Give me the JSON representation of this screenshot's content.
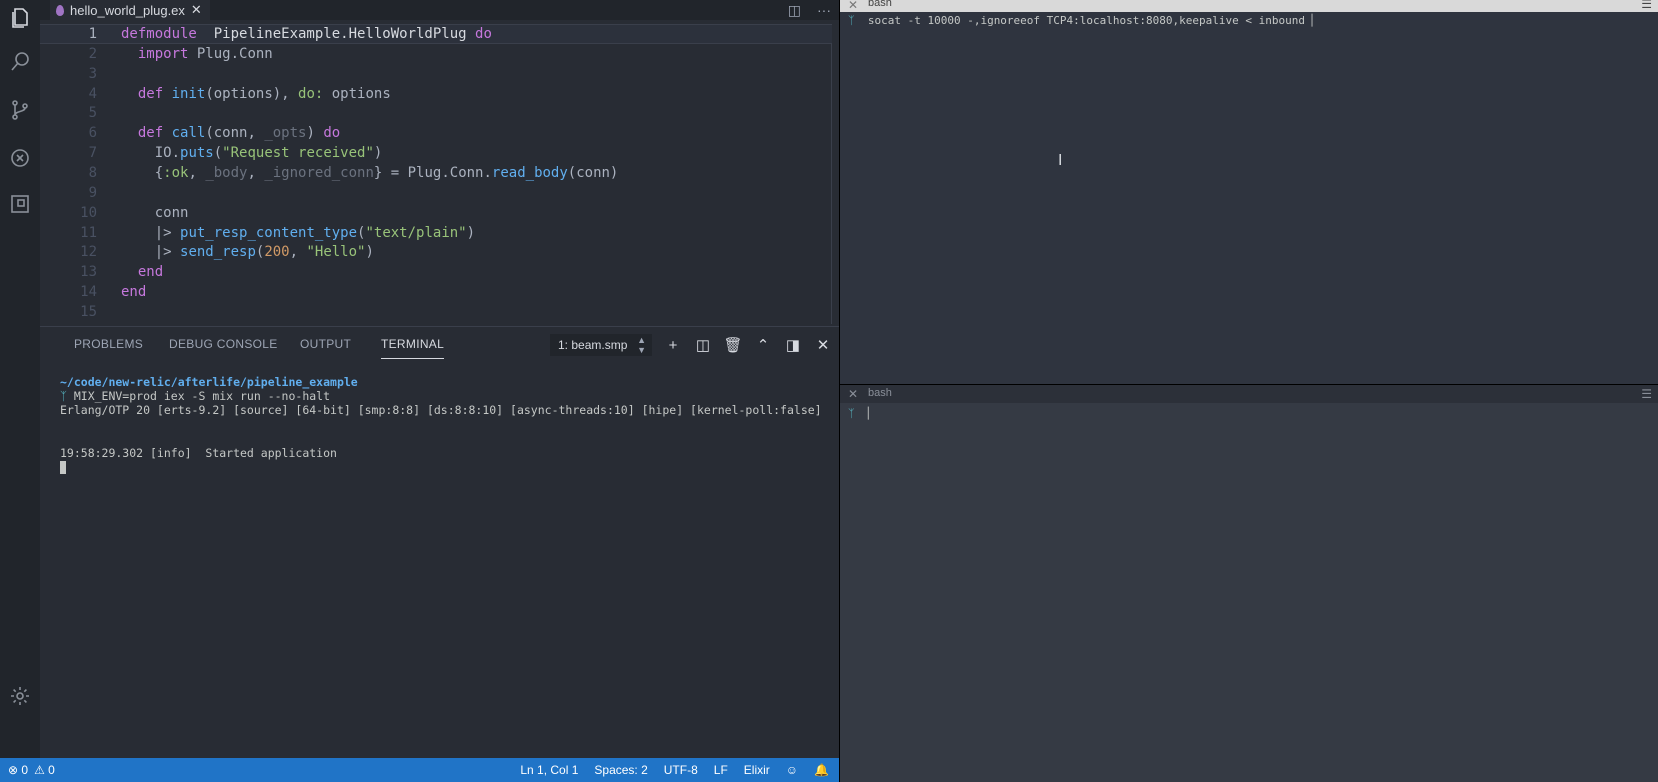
{
  "editor": {
    "tab_name": "hello_world_plug.ex",
    "lines": [
      {
        "n": "1",
        "segs": [
          [
            "kw",
            "defmodule"
          ],
          [
            "",
            "  "
          ],
          [
            "mod",
            "PipelineExample.HelloWorldPlug"
          ],
          [
            "",
            " "
          ],
          [
            "kw",
            "do"
          ]
        ]
      },
      {
        "n": "2",
        "segs": [
          [
            "",
            "  "
          ],
          [
            "kw",
            "import"
          ],
          [
            "",
            " Plug.Conn"
          ]
        ]
      },
      {
        "n": "3",
        "segs": []
      },
      {
        "n": "4",
        "segs": [
          [
            "",
            "  "
          ],
          [
            "kw",
            "def"
          ],
          [
            "",
            " "
          ],
          [
            "fn",
            "init"
          ],
          [
            "",
            "(options), "
          ],
          [
            "atom",
            "do:"
          ],
          [
            "",
            " options"
          ]
        ]
      },
      {
        "n": "5",
        "segs": []
      },
      {
        "n": "6",
        "segs": [
          [
            "",
            "  "
          ],
          [
            "kw",
            "def"
          ],
          [
            "",
            " "
          ],
          [
            "fn",
            "call"
          ],
          [
            "",
            "(conn, "
          ],
          [
            "dim",
            "_opts"
          ],
          [
            "",
            ") "
          ],
          [
            "kw",
            "do"
          ]
        ]
      },
      {
        "n": "7",
        "segs": [
          [
            "",
            "    IO."
          ],
          [
            "fn",
            "puts"
          ],
          [
            "",
            "("
          ],
          [
            "str",
            "\"Request received\""
          ],
          [
            "",
            ")"
          ]
        ]
      },
      {
        "n": "8",
        "segs": [
          [
            "",
            "    {"
          ],
          [
            "atom",
            ":ok"
          ],
          [
            "",
            ", "
          ],
          [
            "dim",
            "_body"
          ],
          [
            "",
            ", "
          ],
          [
            "dim",
            "_ignored_conn"
          ],
          [
            "",
            "} = Plug.Conn."
          ],
          [
            "fn",
            "read_body"
          ],
          [
            "",
            "(conn)"
          ]
        ]
      },
      {
        "n": "9",
        "segs": []
      },
      {
        "n": "10",
        "segs": [
          [
            "",
            "    conn"
          ]
        ]
      },
      {
        "n": "11",
        "segs": [
          [
            "",
            "    |> "
          ],
          [
            "fn",
            "put_resp_content_type"
          ],
          [
            "",
            "("
          ],
          [
            "str",
            "\"text/plain\""
          ],
          [
            "",
            ")"
          ]
        ]
      },
      {
        "n": "12",
        "segs": [
          [
            "",
            "    |> "
          ],
          [
            "fn",
            "send_resp"
          ],
          [
            "",
            "("
          ],
          [
            "num",
            "200"
          ],
          [
            "",
            ", "
          ],
          [
            "str",
            "\"Hello\""
          ],
          [
            "",
            ")"
          ]
        ]
      },
      {
        "n": "13",
        "segs": [
          [
            "",
            "  "
          ],
          [
            "kw",
            "end"
          ]
        ]
      },
      {
        "n": "14",
        "segs": [
          [
            "kw",
            "end"
          ]
        ]
      },
      {
        "n": "15",
        "segs": []
      }
    ]
  },
  "panel": {
    "tabs": {
      "problems": "PROBLEMS",
      "debug": "DEBUG CONSOLE",
      "output": "OUTPUT",
      "terminal": "TERMINAL"
    },
    "terminal_select": "1: beam.smp",
    "terminal_lines": {
      "path": "~/code/new-relic/afterlife/pipeline_example",
      "prompt_icon": "ᛉ",
      "command": "MIX_ENV=prod iex -S mix run --no-halt",
      "erlang": "Erlang/OTP 20 [erts-9.2] [source] [64-bit] [smp:8:8] [ds:8:8:10] [async-threads:10] [hipe] [kernel-poll:false]",
      "started": "19:58:29.302 [info]  Started application"
    }
  },
  "status": {
    "errors": "0",
    "warnings": "0",
    "position": "Ln 1, Col 1",
    "spaces": "Spaces: 2",
    "encoding": "UTF-8",
    "eol": "LF",
    "language": "Elixir"
  },
  "panes": {
    "top_title": "bash",
    "top_command": "socat -t 10000 -,ignoreeof TCP4:localhost:8080,keepalive < inbound ",
    "bottom_title": "bash"
  },
  "colors": {
    "accent": "#2074c7",
    "editor_bg": "#282c34",
    "pane_bg": "#2f343f"
  }
}
